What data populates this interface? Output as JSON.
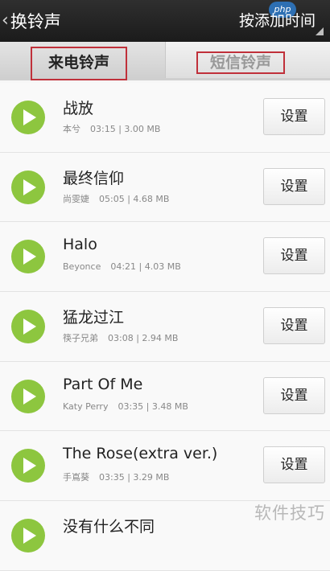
{
  "header": {
    "back_chevron": "‹",
    "title": "换铃声",
    "sort_label": "按添加时间",
    "watermark": "php"
  },
  "tabs": [
    {
      "label": "来电铃声",
      "active": true
    },
    {
      "label": "短信铃声",
      "active": false
    }
  ],
  "songs": [
    {
      "name": "战放",
      "artist": "本兮",
      "duration": "03:15",
      "size": "3.00 MB",
      "button": "设置"
    },
    {
      "name": "最终信仰",
      "artist": "尚雯婕",
      "duration": "05:05",
      "size": "4.68 MB",
      "button": "设置"
    },
    {
      "name": "Halo",
      "artist": "Beyonce",
      "duration": "04:21",
      "size": "4.03 MB",
      "button": "设置"
    },
    {
      "name": "猛龙过江",
      "artist": "筷子兄弟",
      "duration": "03:08",
      "size": "2.94 MB",
      "button": "设置"
    },
    {
      "name": "Part Of Me",
      "artist": "Katy Perry",
      "duration": "03:35",
      "size": "3.48 MB",
      "button": "设置"
    },
    {
      "name": "The Rose(extra ver.)",
      "artist": "手嶌葵",
      "duration": "03:35",
      "size": "3.29 MB",
      "button": "设置"
    },
    {
      "name": "没有什么不同",
      "artist": "",
      "duration": "",
      "size": "",
      "button": ""
    }
  ],
  "watermark_bottom": "软件技巧",
  "colors": {
    "play": "#8dc63f",
    "tab_highlight": "#c0303a",
    "topbar": "#1b1b1b"
  },
  "icons": {
    "back": "chevron-left-icon",
    "play": "play-icon",
    "sort": "corner-caret-icon"
  }
}
